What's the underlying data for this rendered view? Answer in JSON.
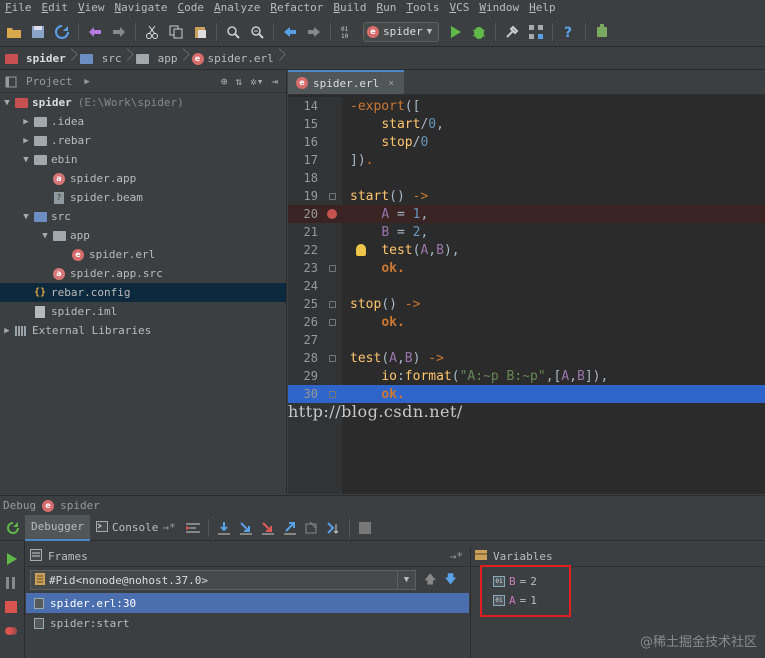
{
  "menu": [
    "File",
    "Edit",
    "View",
    "Navigate",
    "Code",
    "Analyze",
    "Refactor",
    "Build",
    "Run",
    "Tools",
    "VCS",
    "Window",
    "Help"
  ],
  "toolbar": {
    "run_config": "spider"
  },
  "breadcrumbs": [
    "spider",
    "src",
    "app",
    "spider.erl"
  ],
  "project": {
    "title": "Project",
    "tree": [
      {
        "indent": 0,
        "arrow": "▼",
        "icon": "folder-red",
        "label": "spider",
        "extra": "(E:\\Work\\spider)",
        "bold": true
      },
      {
        "indent": 1,
        "arrow": "▶",
        "icon": "folder",
        "label": ".idea"
      },
      {
        "indent": 1,
        "arrow": "▶",
        "icon": "folder",
        "label": ".rebar"
      },
      {
        "indent": 1,
        "arrow": "▼",
        "icon": "folder",
        "label": "ebin"
      },
      {
        "indent": 2,
        "arrow": "",
        "icon": "file-a",
        "label": "spider.app"
      },
      {
        "indent": 2,
        "arrow": "",
        "icon": "file-q",
        "label": "spider.beam"
      },
      {
        "indent": 1,
        "arrow": "▼",
        "icon": "folder-blue",
        "label": "src"
      },
      {
        "indent": 2,
        "arrow": "▼",
        "icon": "folder",
        "label": "app"
      },
      {
        "indent": 3,
        "arrow": "",
        "icon": "file-e",
        "label": "spider.erl"
      },
      {
        "indent": 2,
        "arrow": "",
        "icon": "file-a",
        "label": "spider.app.src"
      },
      {
        "indent": 1,
        "arrow": "",
        "icon": "file-cfg",
        "label": "rebar.config",
        "selected": true
      },
      {
        "indent": 1,
        "arrow": "",
        "icon": "file-iml",
        "label": "spider.iml"
      },
      {
        "indent": 0,
        "arrow": "▶",
        "icon": "file-lib",
        "label": "External Libraries"
      }
    ]
  },
  "editor": {
    "tab": "spider.erl",
    "lines": [
      {
        "n": "14",
        "html": "<span class='k'>-export</span>(["
      },
      {
        "n": "15",
        "html": "    <span class='f'>start</span>/<span class='n'>0</span>,"
      },
      {
        "n": "16",
        "html": "    <span class='f'>stop</span>/<span class='n'>0</span>"
      },
      {
        "n": "17",
        "html": "])<span class='k'>.</span>"
      },
      {
        "n": "18",
        "html": ""
      },
      {
        "n": "19",
        "html": "<span class='f'>start</span>() <span class='k'>-&gt;</span>",
        "fold": true
      },
      {
        "n": "20",
        "html": "    <span class='v'>A</span> = <span class='n'>1</span>,",
        "bp": true
      },
      {
        "n": "21",
        "html": "    <span class='v'>B</span> = <span class='n'>2</span>,"
      },
      {
        "n": "22",
        "html": "    <span class='f'>test</span>(<span class='v'>A</span>,<span class='v'>B</span>),",
        "bulb": true
      },
      {
        "n": "23",
        "html": "    <span class='bold'>ok.</span>",
        "fold": true
      },
      {
        "n": "24",
        "html": ""
      },
      {
        "n": "25",
        "html": "<span class='f'>stop</span>() <span class='k'>-&gt;</span>",
        "fold": true
      },
      {
        "n": "26",
        "html": "    <span class='bold'>ok.</span>",
        "fold": true
      },
      {
        "n": "27",
        "html": ""
      },
      {
        "n": "28",
        "html": "<span class='f'>test</span>(<span class='v'>A</span>,<span class='v'>B</span>) <span class='k'>-&gt;</span>",
        "fold": true
      },
      {
        "n": "29",
        "html": "    <span class='f'>io</span>:<span class='f'>format</span>(<span class='s'>\"A:~p B:~p\"</span>,[<span class='v'>A</span>,<span class='v'>B</span>]),",
        "fold": false
      },
      {
        "n": "30",
        "html": "    <span class='bold'>ok.</span>",
        "cur": true,
        "fold": true
      }
    ],
    "watermark": "http://blog.csdn.net/"
  },
  "debug": {
    "title": "Debug",
    "config": "spider",
    "tabs": {
      "debugger": "Debugger",
      "console": "Console"
    },
    "frames_title": "Frames",
    "thread": "#Pid<nonode@nohost.37.0>",
    "frames": [
      "spider.erl:30",
      "spider:start"
    ],
    "variables_title": "Variables",
    "variables": [
      {
        "name": "B",
        "value": "2"
      },
      {
        "name": "A",
        "value": "1"
      }
    ]
  },
  "site_mark": "@稀土掘金技术社区",
  "colors": {
    "accent": "#4a88c7",
    "selection": "#2f65ca",
    "breakpoint": "#c75450",
    "highlight_box": "#e02020"
  }
}
